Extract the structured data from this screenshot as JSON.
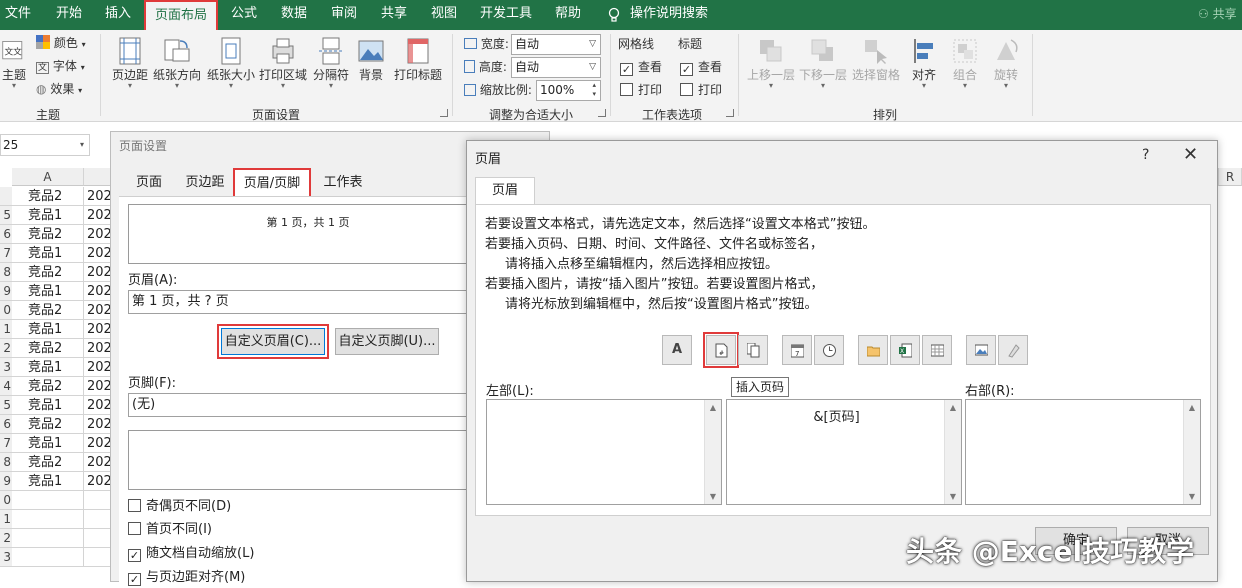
{
  "tabs": [
    "文件",
    "开始",
    "插入",
    "页面布局",
    "公式",
    "数据",
    "审阅",
    "共享",
    "视图",
    "开发工具",
    "帮助",
    "操作说明搜索"
  ],
  "share_label": "共享",
  "ribbon": {
    "theme_group": {
      "label": "主题",
      "theme_btn": "主题",
      "colors": "颜色",
      "fonts": "字体",
      "effects": "效果"
    },
    "page_setup_group": {
      "label": "页面设置",
      "buttons": [
        "页边距",
        "纸张方向",
        "纸张大小",
        "打印区域",
        "分隔符",
        "背景",
        "打印标题"
      ]
    },
    "scale_group": {
      "label": "调整为合适大小",
      "width_label": "宽度:",
      "width_value": "自动",
      "height_label": "高度:",
      "height_value": "自动",
      "scale_label": "缩放比例:",
      "scale_value": "100%"
    },
    "sheet_options_group": {
      "label": "工作表选项",
      "gridlines": "网格线",
      "headings": "标题",
      "view": "查看",
      "print": "打印"
    },
    "arrange_group": {
      "label": "排列",
      "buttons": [
        "上移一层",
        "下移一层",
        "选择窗格",
        "对齐",
        "组合",
        "旋转"
      ]
    }
  },
  "namebox_value": "25",
  "sheet": {
    "col_a": "A",
    "row_numbers": [
      "",
      "5",
      "6",
      "7",
      "8",
      "9",
      "0",
      "1",
      "2",
      "3",
      "4",
      "5",
      "6",
      "7",
      "8",
      "9",
      "0",
      "1",
      "2",
      "3"
    ],
    "cells": [
      "竞品2",
      "竞品1",
      "竞品2",
      "竞品1",
      "竞品2",
      "竞品1",
      "竞品2",
      "竞品1",
      "竞品2",
      "竞品1",
      "竞品2",
      "竞品1",
      "竞品2",
      "竞品1",
      "竞品2",
      "竞品1"
    ],
    "col_b_text": "202",
    "right_col": "R"
  },
  "page_setup": {
    "title": "页面设置",
    "tabs": [
      "页面",
      "页边距",
      "页眉/页脚",
      "工作表"
    ],
    "header_preview": "第 1 页，共 1 页",
    "header_label": "页眉(A):",
    "header_value": "第 1 页，共 ? 页",
    "custom_header_btn": "自定义页眉(C)...",
    "custom_footer_btn": "自定义页脚(U)...",
    "footer_label": "页脚(F):",
    "footer_value": "(无)",
    "checks": [
      {
        "label": "奇偶页不同(D)",
        "checked": false
      },
      {
        "label": "首页不同(I)",
        "checked": false
      },
      {
        "label": "随文档自动缩放(L)",
        "checked": true
      },
      {
        "label": "与页边距对齐(M)",
        "checked": true
      }
    ]
  },
  "header_dialog": {
    "title": "页眉",
    "help": "?",
    "close": "✕",
    "tab": "页眉",
    "instructions": [
      "若要设置文本格式，请先选定文本，然后选择“设置文本格式”按钮。",
      "若要插入页码、日期、时间、文件路径、文件名或标签名，",
      "请将插入点移至编辑框内，然后选择相应按钮。",
      "若要插入图片，请按“插入图片”按钮。若要设置图片格式，",
      "请将光标放到编辑框中，然后按“设置图片格式”按钮。"
    ],
    "tooltip": "插入页码",
    "left_label": "左部(L):",
    "center_value": "&[页码]",
    "right_label": "右部(R):",
    "ok": "确定",
    "cancel": "取消"
  },
  "watermark": "头条 @Excel技巧教学",
  "colors": {
    "excel_green": "#217346",
    "highlight_red": "#e03a3a"
  }
}
